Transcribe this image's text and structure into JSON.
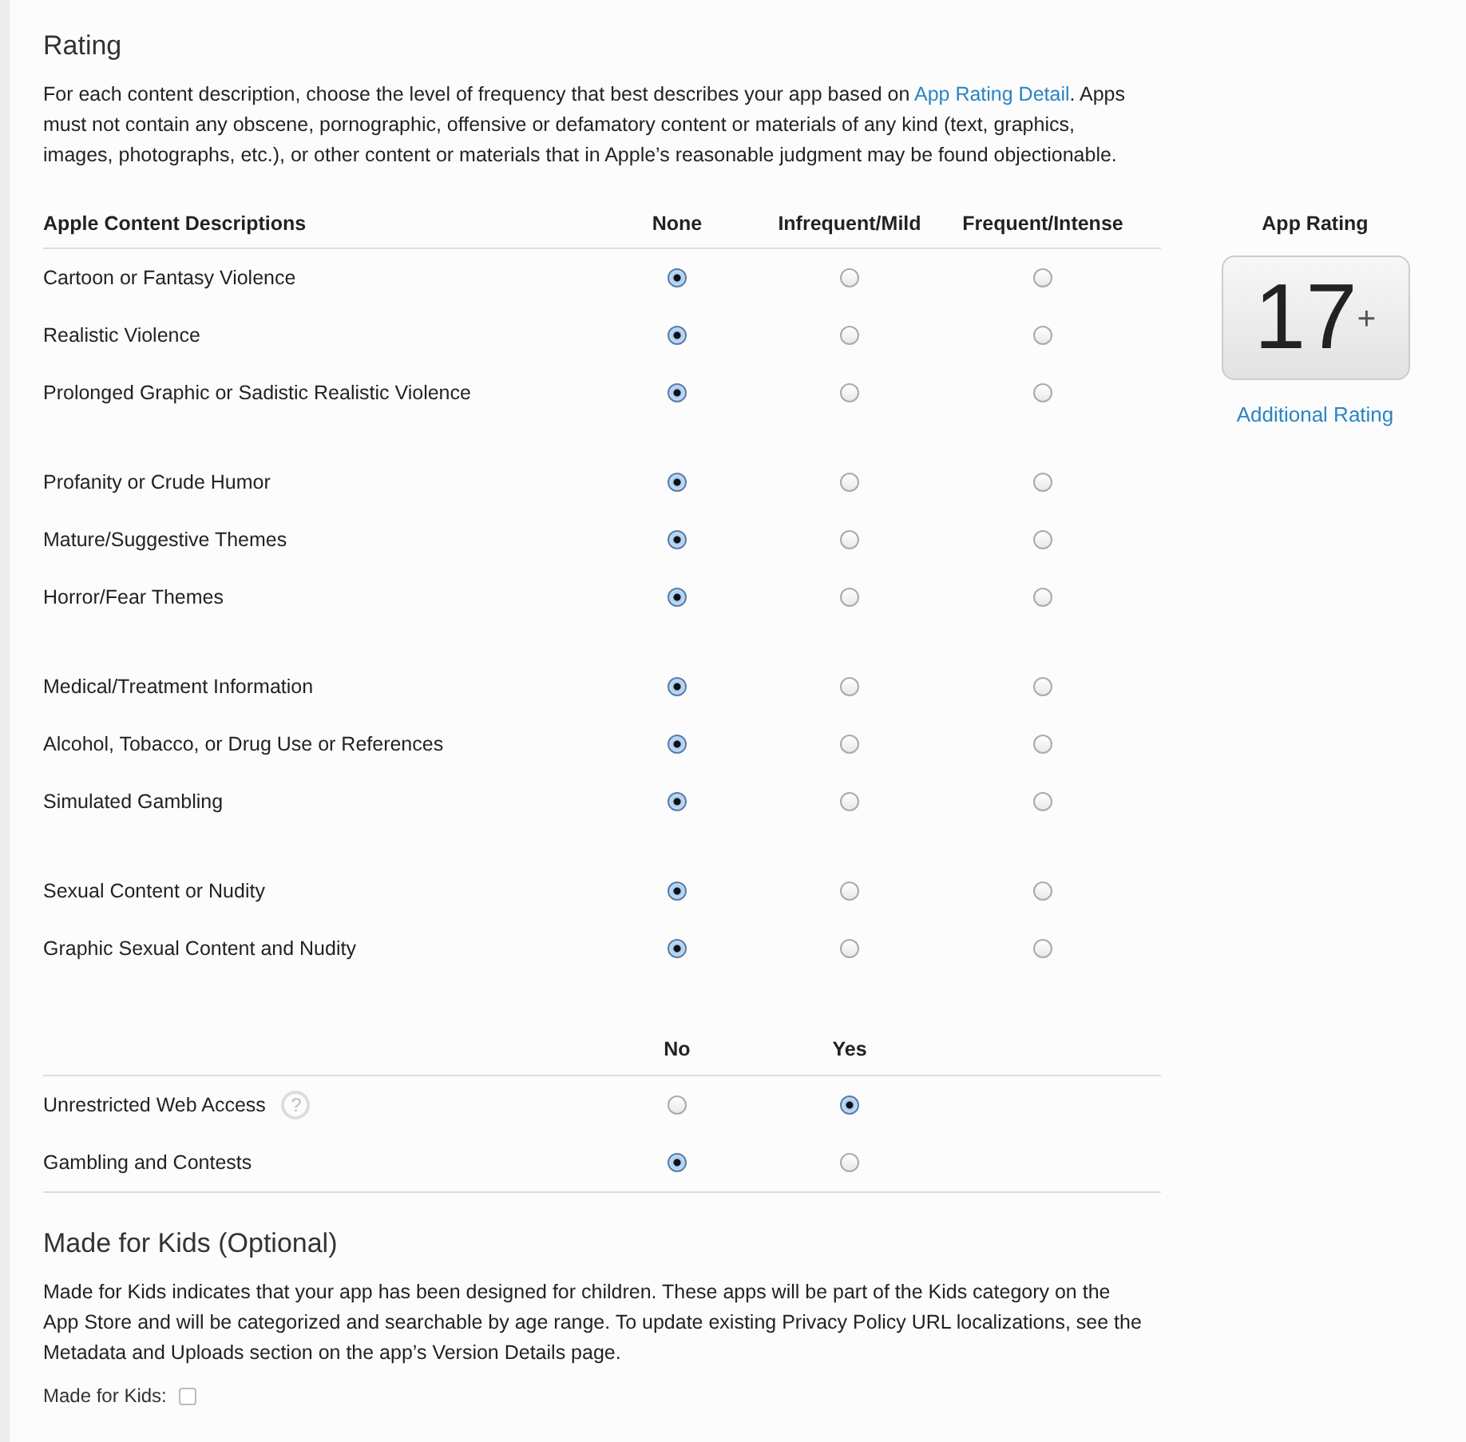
{
  "rating": {
    "title": "Rating",
    "intro": [
      {
        "kind": "text",
        "text": "For each content description, choose the level of frequency that best describes your app based on "
      },
      {
        "kind": "link",
        "text": "App Rating Detail"
      },
      {
        "kind": "text",
        "text": ". Apps must not contain any obscene, pornographic, offensive or defamatory content or materials of any kind (text, graphics, images, photographs, etc.), or other content or materials that in Apple’s reasonable judgment may be found objectionable."
      }
    ],
    "columns": [
      "Apple Content Descriptions",
      "None",
      "Infrequent/Mild",
      "Frequent/Intense"
    ],
    "groups": [
      {
        "rows": [
          {
            "label": "Cartoon or Fantasy Violence",
            "options": [
              {
                "selected": true
              },
              {
                "selected": false
              },
              {
                "selected": false
              }
            ]
          },
          {
            "label": "Realistic Violence",
            "options": [
              {
                "selected": true
              },
              {
                "selected": false
              },
              {
                "selected": false
              }
            ]
          },
          {
            "label": "Prolonged Graphic or Sadistic Realistic Violence",
            "options": [
              {
                "selected": true
              },
              {
                "selected": false
              },
              {
                "selected": false
              }
            ]
          }
        ]
      },
      {
        "rows": [
          {
            "label": "Profanity or Crude Humor",
            "options": [
              {
                "selected": true
              },
              {
                "selected": false
              },
              {
                "selected": false
              }
            ]
          },
          {
            "label": "Mature/Suggestive Themes",
            "options": [
              {
                "selected": true
              },
              {
                "selected": false
              },
              {
                "selected": false
              }
            ]
          },
          {
            "label": "Horror/Fear Themes",
            "options": [
              {
                "selected": true
              },
              {
                "selected": false
              },
              {
                "selected": false
              }
            ]
          }
        ]
      },
      {
        "rows": [
          {
            "label": "Medical/Treatment Information",
            "options": [
              {
                "selected": true
              },
              {
                "selected": false
              },
              {
                "selected": false
              }
            ]
          },
          {
            "label": "Alcohol, Tobacco, or Drug Use or References",
            "options": [
              {
                "selected": true
              },
              {
                "selected": false
              },
              {
                "selected": false
              }
            ]
          },
          {
            "label": "Simulated Gambling",
            "options": [
              {
                "selected": true
              },
              {
                "selected": false
              },
              {
                "selected": false
              }
            ]
          }
        ]
      },
      {
        "rows": [
          {
            "label": "Sexual Content or Nudity",
            "options": [
              {
                "selected": true
              },
              {
                "selected": false
              },
              {
                "selected": false
              }
            ]
          },
          {
            "label": "Graphic Sexual Content and Nudity",
            "options": [
              {
                "selected": true
              },
              {
                "selected": false
              },
              {
                "selected": false
              }
            ]
          }
        ]
      }
    ],
    "yes_no": {
      "columns": [
        "No",
        "Yes"
      ],
      "rows": [
        {
          "label": "Unrestricted Web Access",
          "help": "?",
          "options": [
            {
              "selected": false
            },
            {
              "selected": true
            }
          ]
        },
        {
          "label": "Gambling and Contests",
          "options": [
            {
              "selected": true
            },
            {
              "selected": false
            }
          ]
        }
      ]
    },
    "app_rating": {
      "title": "App Rating",
      "value": "17$^{+}$",
      "link": "Additional Rating"
    }
  },
  "made_for_kids": {
    "title": "Made for Kids (Optional)",
    "text": "Made for Kids indicates that your app has been designed for children. These apps will be part of the Kids category on the App Store and will be categorized and searchable by age range. To update existing Privacy Policy URL localizations, see the Metadata and Uploads section on the app’s Version Details page.",
    "checkbox": {
      "label": "Made for Kids:",
      "checked": false
    }
  }
}
